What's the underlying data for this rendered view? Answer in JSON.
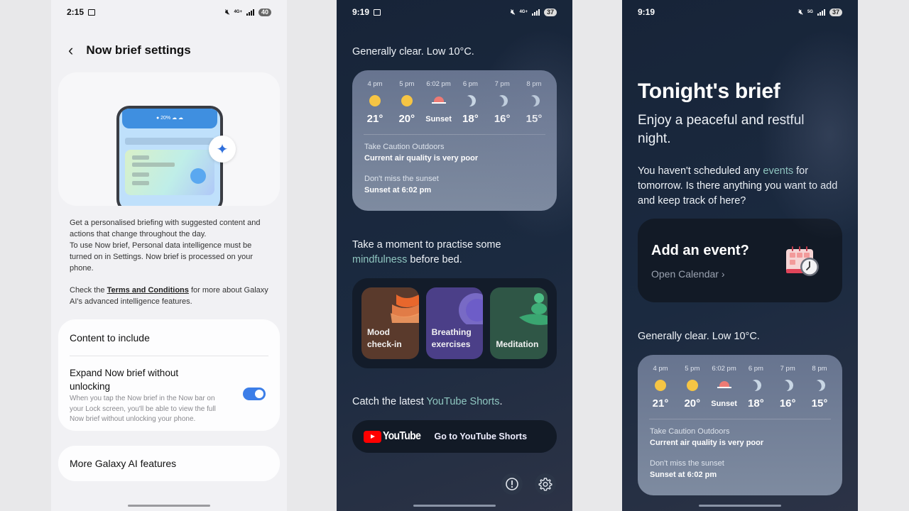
{
  "panel1": {
    "status": {
      "time": "2:15",
      "network": "4G+",
      "battery": "40"
    },
    "title": "Now brief settings",
    "illustration": {
      "humidity_label": "20%"
    },
    "description": {
      "para1": "Get a personalised briefing with suggested content and actions that change throughout the day.",
      "para2": "To use Now brief, Personal data intelligence must be turned on in Settings. Now brief is processed on your phone.",
      "terms_prefix": "Check the ",
      "terms_link": "Terms and Conditions",
      "terms_suffix": " for more about Galaxy AI's advanced intelligence features."
    },
    "settings": {
      "content_to_include": "Content to include",
      "expand_title": "Expand Now brief without unlocking",
      "expand_subtitle": "When you tap the Now brief in the Now bar on your Lock screen, you'll be able to view the full Now brief without unlocking your phone.",
      "expand_enabled": true,
      "more_features": "More Galaxy AI features"
    }
  },
  "panel2": {
    "status": {
      "time": "9:19",
      "network": "4G+",
      "battery": "37"
    },
    "weather_summary": "Generally clear. Low 10°C.",
    "forecast": [
      {
        "time": "4 pm",
        "icon": "sun",
        "value": "21°"
      },
      {
        "time": "5 pm",
        "icon": "sun",
        "value": "20°"
      },
      {
        "time": "6:02 pm",
        "icon": "sunset",
        "value": "Sunset"
      },
      {
        "time": "6 pm",
        "icon": "moon",
        "value": "18°"
      },
      {
        "time": "7 pm",
        "icon": "moon",
        "value": "16°"
      },
      {
        "time": "8 pm",
        "icon": "moon",
        "value": "15°"
      }
    ],
    "alerts": [
      {
        "label": "Take Caution Outdoors",
        "value": "Current air quality is very poor"
      },
      {
        "label": "Don't miss the sunset",
        "value": "Sunset at 6:02 pm"
      }
    ],
    "mindfulness": {
      "prefix": "Take a moment to practise some ",
      "accent": "mindfulness",
      "suffix": " before bed.",
      "tiles": [
        {
          "label": "Mood check-in",
          "color": "#5a3a2c"
        },
        {
          "label": "Breathing exercises",
          "color": "#4b3f88"
        },
        {
          "label": "Meditation",
          "color": "#2f5646"
        }
      ]
    },
    "youtube": {
      "prefix": "Catch the latest ",
      "accent": "YouTube Shorts",
      "suffix": ".",
      "logo_text": "YouTube",
      "button_label": "Go to YouTube Shorts"
    },
    "footer_icons": [
      "info-icon",
      "gear-icon"
    ]
  },
  "panel3": {
    "status": {
      "time": "9:19",
      "network": "5G",
      "battery": "37"
    },
    "title": "Tonight's brief",
    "subtitle": "Enjoy a peaceful and restful night.",
    "events_msg": {
      "prefix": "You haven't scheduled any ",
      "accent": "events",
      "suffix": " for tomorrow. Is there anything you want to add and keep track of here?"
    },
    "event_card": {
      "title": "Add an event?",
      "link": "Open Calendar"
    },
    "weather_summary": "Generally clear. Low 10°C."
  },
  "colors": {
    "accent_text": "#8fc6c0",
    "toggle_on": "#3c7ee8",
    "sun": "#f6c544",
    "sunset": "#ee7a74",
    "youtube_red": "#ff0000"
  }
}
